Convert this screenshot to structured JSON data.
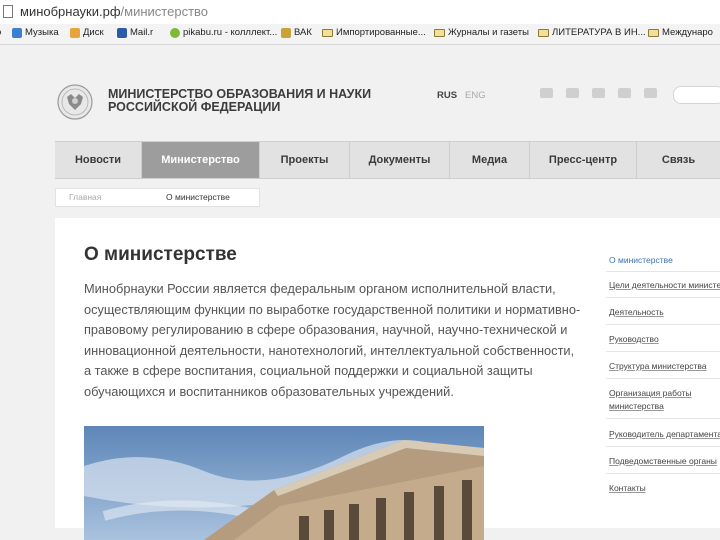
{
  "browser": {
    "url_host": "минобрнауки.рф",
    "url_path": "/министерство",
    "bookmarks": [
      {
        "label": "Музыка",
        "icon": "music-icon"
      },
      {
        "label": "Диск",
        "icon": "disk-icon"
      },
      {
        "label": "Mail.r",
        "icon": "mail-icon"
      },
      {
        "label": "pikabu.ru - колллект...",
        "icon": "pikabu-icon"
      },
      {
        "label": "ВАК",
        "icon": "vak-icon"
      },
      {
        "label": "Импортированные...",
        "icon": "folder-icon"
      },
      {
        "label": "Журналы и газеты",
        "icon": "folder-icon"
      },
      {
        "label": "ЛИТЕРАТУРА В ИН...",
        "icon": "folder-icon"
      },
      {
        "label": "Междунаро",
        "icon": "folder-icon"
      }
    ]
  },
  "header": {
    "org_line1": "МИНИСТЕРСТВО ОБРАЗОВАНИЯ И НАУКИ",
    "org_line2": "РОССИЙСКОЙ ФЕДЕРАЦИИ",
    "lang_active": "RUS",
    "lang_other": "ENG",
    "logo_icon": "emblem-icon",
    "social_icons": [
      "comment-icon",
      "video-icon",
      "rss-icon",
      "twitter-icon",
      "links-icon"
    ]
  },
  "nav": {
    "items": [
      "Новости",
      "Министерство",
      "Проекты",
      "Документы",
      "Медиа",
      "Пресс-центр",
      "Связь"
    ],
    "active": "Министерство"
  },
  "breadcrumb": {
    "home": "Главная",
    "current": "О министерстве"
  },
  "content": {
    "title": "О министерстве",
    "lead": "Минобрнауки России является федеральным органом исполнительной власти, осуществляющим функции по выработке государственной политики и нормативно-правовому регулированию в сфере образования, научной, научно-технической и инновационной деятельности, нанотехнологий, интеллектуальной собственности, а также в сфере воспитания, социальной поддержки и социальной защиты обучающихся и воспитанников образовательных учреждений."
  },
  "side_menu": [
    "О министерстве",
    "Цели деятельности министерства",
    "Деятельность",
    "Руководство",
    "Структура министерства",
    "Организация работы",
    "министерства",
    "Руководитель департамента",
    "Подведомственные органы",
    "Контакты"
  ],
  "colors": {
    "nav_active_bg": "#9d9d9d",
    "side_current": "#3d6fb0",
    "page_bg": "#f1f1f1"
  }
}
